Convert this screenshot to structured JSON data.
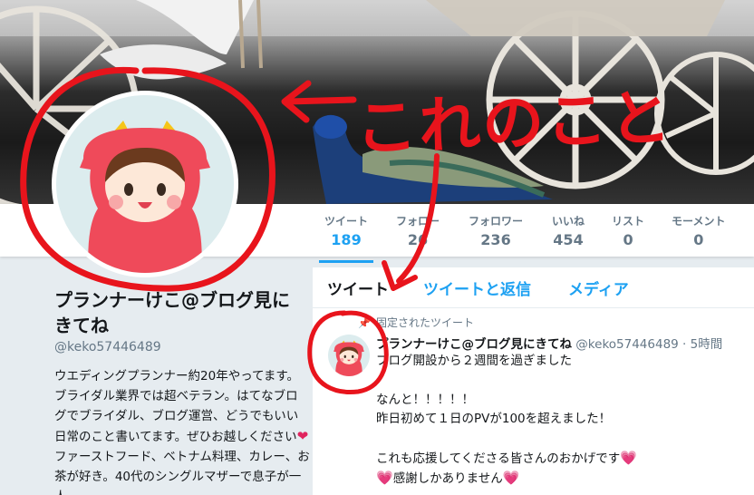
{
  "stats": [
    {
      "label": "ツイート",
      "value": "189"
    },
    {
      "label": "フォロー",
      "value": "26"
    },
    {
      "label": "フォロワー",
      "value": "236"
    },
    {
      "label": "いいね",
      "value": "454"
    },
    {
      "label": "リスト",
      "value": "0"
    },
    {
      "label": "モーメント",
      "value": "0"
    }
  ],
  "profile": {
    "name": "プランナーけこ@ブログ見にきてね",
    "handle": "@keko57446489",
    "bio_parts": [
      "ウエディングプランナー約20年やってます。ブライダル業界では超ベテラン。はてなブログでブライダル、ブログ運営、どうでもいい日常のこと書いてます。ぜひお越しください",
      "ファーストフード、ベトナム料理、カレー、お茶が好き。40代のシングルマザーで息子が一人。"
    ]
  },
  "tabs": [
    "ツイート",
    "ツイートと返信",
    "メディア"
  ],
  "tweet": {
    "pinned_label": "固定されたツイート",
    "name": "プランナーけこ@ブログ見にきてね",
    "handle": "@keko57446489",
    "separator": "·",
    "time": "5時間",
    "lines": [
      "ブログ開設から２週間を過ぎました",
      "",
      "なんと！！！！！",
      "昨日初めて１日のPVが100を超えました！",
      "",
      "これも応援してくださる皆さんのおかげです",
      "感謝しかありません"
    ]
  },
  "annotation": {
    "text": "これのこと",
    "color": "#e8141c"
  },
  "colors": {
    "accent": "#1da1f2",
    "annotation_red": "#e8141c",
    "heart": "#e0245e"
  }
}
